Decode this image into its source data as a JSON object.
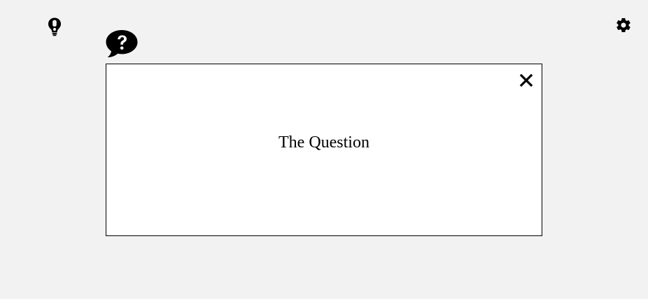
{
  "question_card": {
    "text": "The Question"
  },
  "toolbar": {
    "hint_icon": "lightbulb-exclamation-icon",
    "settings_icon": "gear-icon",
    "question_icon": "question-speech-bubble-icon",
    "close_icon": "close-icon"
  },
  "colors": {
    "background": "#f2f2f2",
    "card": "#ffffff",
    "icon": "#000000"
  }
}
